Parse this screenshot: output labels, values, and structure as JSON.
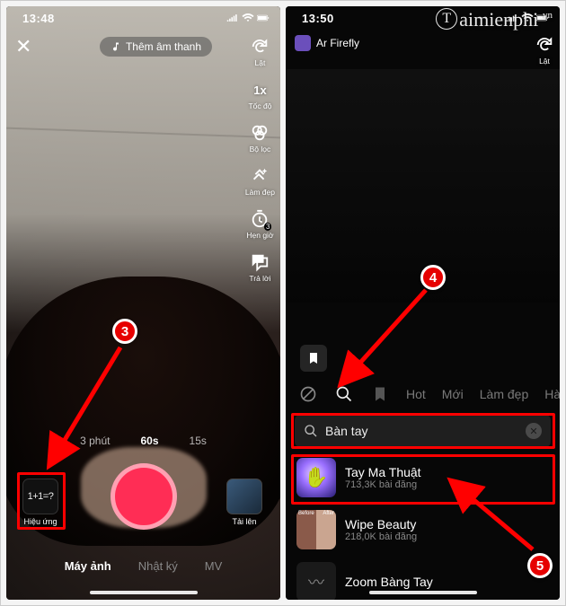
{
  "watermark": {
    "main": "aimienphi",
    "circled": "T",
    "suffix": ".vn"
  },
  "markers": {
    "m3": "3",
    "m4": "4",
    "m5": "5"
  },
  "left": {
    "status_time": "13:48",
    "sound_label": "Thêm âm thanh",
    "tools": {
      "flip": "Lật",
      "speed": "Tốc độ",
      "speed_val": "1x",
      "filter": "Bộ lọc",
      "beauty": "Làm đẹp",
      "timer": "Hẹn giờ",
      "timer_val": "3",
      "reply": "Trả lời"
    },
    "durations": {
      "d1": "3 phút",
      "d2": "60s",
      "d3": "15s"
    },
    "effects_label": "Hiệu ứng",
    "effects_thumb": "1+1=?",
    "upload_label": "Tải lên",
    "modes": {
      "camera": "Máy ảnh",
      "diary": "Nhật ký",
      "mv": "MV"
    }
  },
  "right": {
    "status_time": "13:50",
    "creator": "Ar Firefly",
    "flip_label": "Lật",
    "categories": {
      "hot": "Hot",
      "new": "Mới",
      "beauty": "Làm đẹp",
      "funny": "Hài h"
    },
    "search_value": "Bàn tay",
    "results": [
      {
        "name": "Tay Ma Thuật",
        "sub": "713,3K bài đăng"
      },
      {
        "name": "Wipe Beauty",
        "sub": "218,0K bài đăng"
      },
      {
        "name": "Zoom Bàng Tay",
        "sub": ""
      }
    ]
  }
}
